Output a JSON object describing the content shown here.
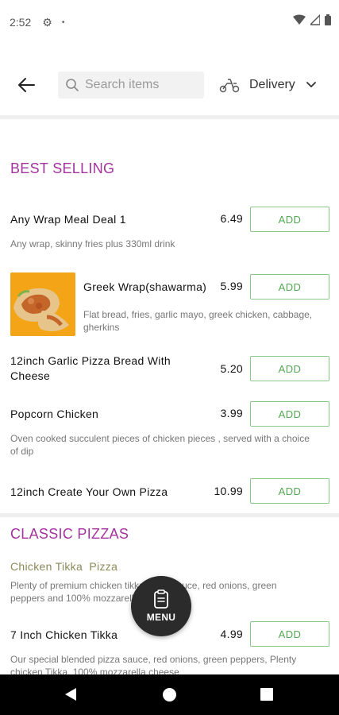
{
  "status_bar": {
    "time": "2:52",
    "dot": "•"
  },
  "header": {
    "search_placeholder": "Search items",
    "delivery_label": "Delivery"
  },
  "sections": [
    {
      "title": "BEST SELLING",
      "items": [
        {
          "name": "Any Wrap Meal Deal 1",
          "price": "6.49",
          "desc": "Any wrap, skinny fries plus 330ml drink",
          "add": "ADD"
        },
        {
          "name": "Greek Wrap(shawarma)",
          "price": "5.99",
          "desc": "Flat bread, fries, garlic mayo, greek chicken, cabbage, gherkins",
          "add": "ADD"
        },
        {
          "name": "12inch Garlic Pizza Bread With Cheese",
          "price": "5.20",
          "desc": "",
          "add": "ADD"
        },
        {
          "name": "Popcorn Chicken",
          "price": "3.99",
          "desc": "Oven cooked succulent pieces of chicken pieces , served with a choice of dip",
          "add": "ADD"
        },
        {
          "name": "12inch Create Your Own Pizza",
          "price": "10.99",
          "desc": "",
          "add": "ADD"
        }
      ]
    },
    {
      "title": "CLASSIC PIZZAS",
      "subheading": "Chicken Tikka  Pizza",
      "subheading_desc": "Plenty of premium chicken tikka pizza sauce, red onions, green peppers and 100% mozzarella cheese",
      "items": [
        {
          "name": "7 Inch Chicken Tikka",
          "price": "4.99",
          "desc": "Our special blended pizza sauce, red onions, green peppers, Plenty chicken Tikka, 100% mozzarella cheese",
          "add": "ADD"
        }
      ]
    }
  ],
  "menu_button": {
    "label": "MENU"
  },
  "colors": {
    "section_title": "#a3339e",
    "add_border": "#8ac88a",
    "add_text": "#54a654",
    "fab": "#2b2b2b"
  }
}
